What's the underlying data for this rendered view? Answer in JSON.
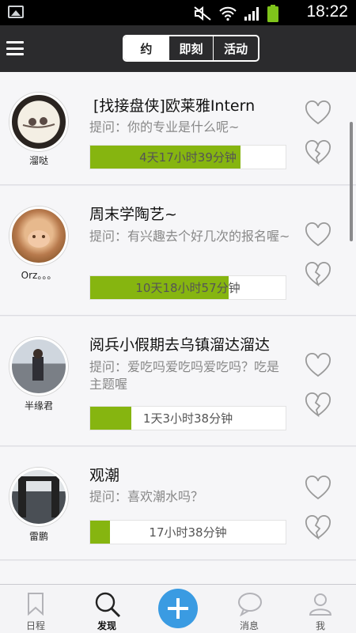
{
  "status_bar": {
    "time": "18:22",
    "icons": [
      "image-icon",
      "mute-icon",
      "wifi-icon",
      "signal-icon",
      "battery-icon"
    ]
  },
  "header": {
    "menu_icon": "menu-icon",
    "tabs": [
      {
        "label": "约",
        "active": true
      },
      {
        "label": "即刻",
        "active": false
      },
      {
        "label": "活动",
        "active": false
      }
    ]
  },
  "items": [
    {
      "user": "溜哒",
      "title": "[找接盘侠]欧莱雅Intern",
      "question": "提问：你的专业是什么呢~",
      "countdown": "4天17小时39分钟",
      "progress": 0.77
    },
    {
      "user": "Orz。。。",
      "title": "周末学陶艺~",
      "question": "提问：有兴趣去个好几次的报名喔~",
      "countdown": "10天18小时57分钟",
      "progress": 0.71
    },
    {
      "user": "半缘君",
      "title": "阅兵小假期去乌镇溜达溜达",
      "question": "提问：爱吃吗爱吃吗爱吃吗？吃是主题喔",
      "countdown": "1天3小时38分钟",
      "progress": 0.21
    },
    {
      "user": "雷鹏",
      "title": "观潮",
      "question": "提问：喜欢潮水吗？",
      "countdown": "17小时38分钟",
      "progress": 0.1
    }
  ],
  "bottom_nav": [
    {
      "label": "日程",
      "icon": "bookmark-icon",
      "active": false
    },
    {
      "label": "发现",
      "icon": "search-icon",
      "active": true
    },
    {
      "label": "",
      "icon": "plus-icon",
      "active": false
    },
    {
      "label": "消息",
      "icon": "chat-bubble-icon",
      "active": false
    },
    {
      "label": "我",
      "icon": "person-icon",
      "active": false
    }
  ],
  "colors": {
    "accent_green": "#86b510",
    "add_button_blue": "#3a9be2",
    "header_bg": "#2b2b2d"
  }
}
